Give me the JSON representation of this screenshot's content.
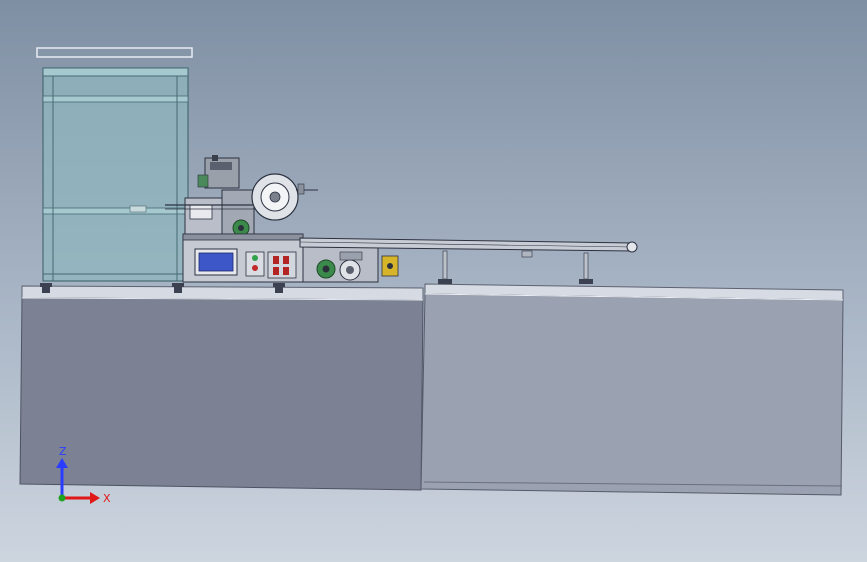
{
  "viewport": {
    "background_top": "#7f8fa3",
    "background_bottom": "#cdd5df"
  },
  "triad": {
    "z_label": "Z",
    "x_label": "X",
    "z_color": "#2a3cff",
    "x_color": "#e01818",
    "y_color": "#1fa31f"
  },
  "colors": {
    "glass": "#8fb6bd",
    "table_left": "#7c8294",
    "table_right": "#9aa1b1",
    "control_screen": "#3d56c8",
    "motor": "#3b8a4b",
    "warning_label": "#d7b52b"
  }
}
